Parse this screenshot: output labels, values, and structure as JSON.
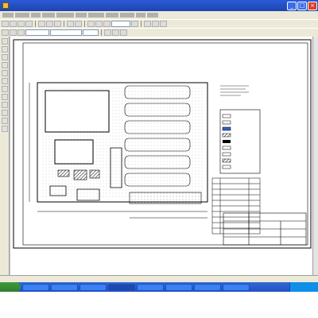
{
  "window": {
    "title": "",
    "minimize_label": "_",
    "maximize_label": "□",
    "close_label": "×"
  },
  "menu": {
    "items": [
      "",
      "",
      "",
      "",
      "",
      "",
      "",
      "",
      "",
      "",
      ""
    ]
  },
  "drawing": {
    "title_block": {
      "title": "",
      "rows": [
        "",
        "",
        "",
        ""
      ]
    },
    "legend": {
      "title": "",
      "items": [
        "",
        "",
        "",
        "",
        "",
        "",
        "",
        "",
        ""
      ]
    },
    "table": {
      "title": "",
      "rows": [
        "",
        "",
        "",
        "",
        "",
        "",
        "",
        "",
        "",
        ""
      ]
    },
    "notes": {
      "lines": [
        "",
        "",
        "",
        ""
      ]
    }
  },
  "status_bar": {
    "text": ""
  },
  "taskbar": {
    "items": [
      "",
      "",
      "",
      "",
      "",
      "",
      "",
      ""
    ]
  },
  "colors": {
    "titlebar": "#1e44b0",
    "taskbar": "#2352c1",
    "drawing_line": "#000000"
  }
}
